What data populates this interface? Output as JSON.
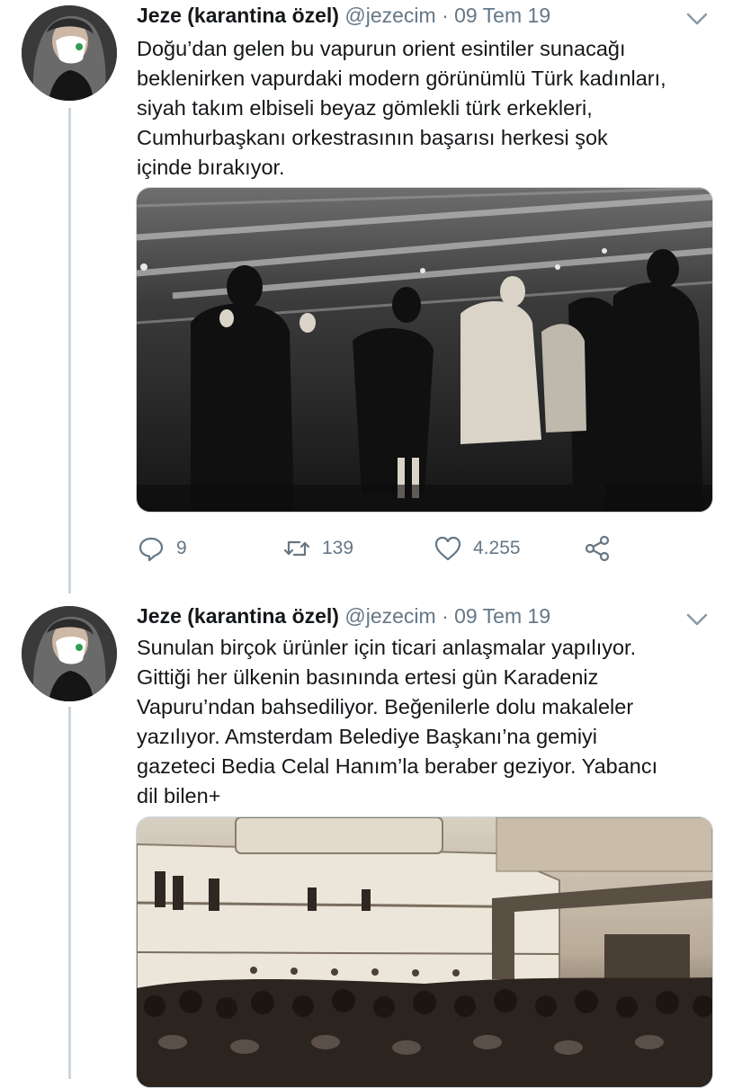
{
  "tweets": [
    {
      "author": {
        "name": "Jeze (karantina özel)",
        "handle": "@jezecim"
      },
      "separator": "·",
      "date": "09 Tem 19",
      "text_lines": [
        "Doğu’dan gelen bu vapurun orient esintiler sunacağı",
        "beklenirken vapurdaki modern görünümlü Türk kadınları,",
        "siyah takım elbiseli beyaz gömlekli türk erkekleri,",
        "Cumhurbaşkanı orkestrasının başarısı herkesi şok",
        "içinde bırakıyor."
      ],
      "media_description": "black-and-white photo of couples dancing on a ship deck",
      "actions": {
        "replies": "9",
        "retweets": "139",
        "likes": "4.255"
      }
    },
    {
      "author": {
        "name": "Jeze (karantina özel)",
        "handle": "@jezecim"
      },
      "separator": "·",
      "date": "09 Tem 19",
      "text_lines": [
        "Sunulan birçok ürünler için ticari anlaşmalar yapılıyor.",
        "Gittiği her ülkenin basınında ertesi gün Karadeniz",
        "Vapuru’ndan bahsediliyor. Beğenilerle dolu makaleler",
        "yazılıyor. Amsterdam Belediye Başkanı’na gemiyi",
        "gazeteci Bedia Celal Hanım’la beraber geziyor. Yabancı",
        "dil bilen+"
      ],
      "media_description": "sepia photo of a large crowd in front of a docked steamship",
      "actions": null
    }
  ],
  "icons": {
    "reply": "reply-icon",
    "retweet": "retweet-icon",
    "like": "heart-icon",
    "share": "share-icon",
    "more": "chevron-down-icon"
  },
  "colors": {
    "text": "#14171a",
    "muted": "#657786",
    "thread_line": "#ccd6dd"
  }
}
